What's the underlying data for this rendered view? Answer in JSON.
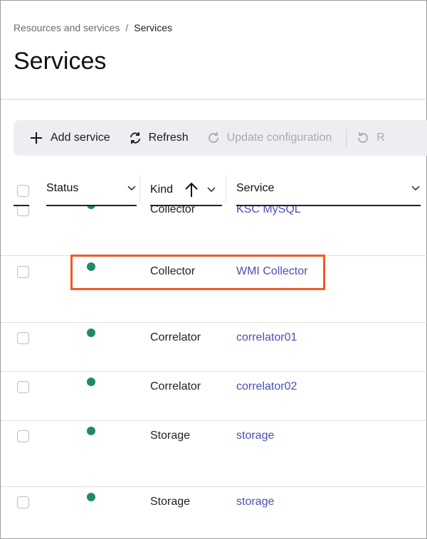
{
  "breadcrumb": {
    "parent": "Resources and services",
    "separator": "/",
    "current": "Services"
  },
  "page_title": "Services",
  "toolbar": {
    "add": "Add service",
    "refresh": "Refresh",
    "update": "Update configuration",
    "restart_partial": "R"
  },
  "table": {
    "headers": {
      "status": "Status",
      "kind": "Kind",
      "service": "Service"
    },
    "sort": {
      "column": "Kind",
      "direction": "ascending"
    },
    "rows": [
      {
        "status": "green",
        "kind": "Collector",
        "service": "KSC MySQL"
      },
      {
        "status": "green",
        "kind": "Collector",
        "service": "WMI Collector",
        "highlighted": true
      },
      {
        "status": "green",
        "kind": "Correlator",
        "service": "correlator01"
      },
      {
        "status": "green",
        "kind": "Correlator",
        "service": "correlator02"
      },
      {
        "status": "green",
        "kind": "Storage",
        "service": "storage"
      },
      {
        "status": "green",
        "kind": "Storage",
        "service": "storage"
      }
    ]
  },
  "colors": {
    "status_ok": "#1d8a6c",
    "link": "#4a4fb3",
    "highlight": "#f05a22"
  }
}
